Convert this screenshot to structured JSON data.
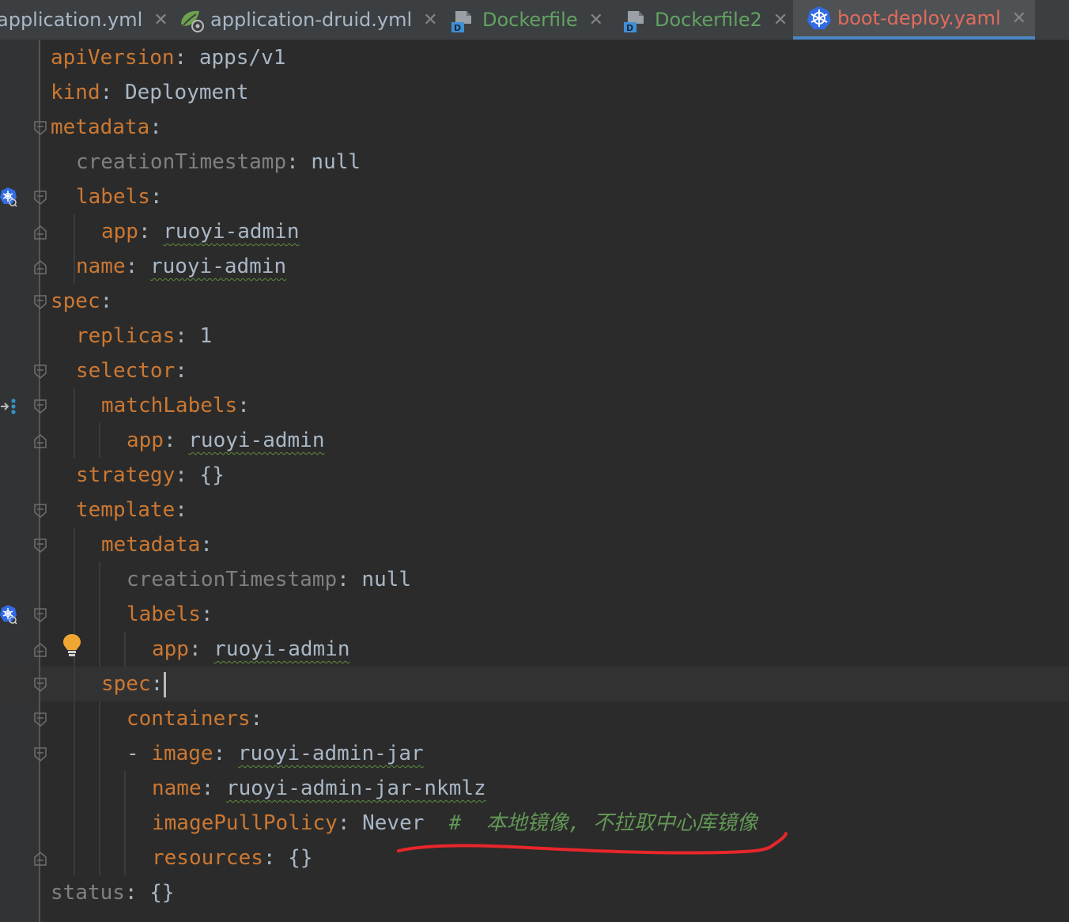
{
  "tabs": [
    {
      "label": "application.yml",
      "kind": "yml",
      "icon": "yml-file-icon"
    },
    {
      "label": "application-druid.yml",
      "kind": "spring-yml",
      "icon": "spring-yml-icon"
    },
    {
      "label": "Dockerfile",
      "kind": "docker",
      "icon": "dockerfile-icon"
    },
    {
      "label": "Dockerfile2",
      "kind": "docker",
      "icon": "dockerfile-icon"
    },
    {
      "label": "boot-deploy.yaml",
      "kind": "kubernetes",
      "icon": "kubernetes-icon",
      "active": true
    }
  ],
  "colors": {
    "key": "#cc7832",
    "key_unused": "#808080",
    "value": "#a9b7c6",
    "comment": "#629755",
    "active_tab_text": "#e26b5d",
    "docker_tab_text": "#62a362",
    "annotation_red": "#e8262b",
    "tab_underline": "#4a88c7"
  },
  "code_lines": [
    {
      "key": "apiVersion",
      "value": "apps/v1"
    },
    {
      "key": "kind",
      "value": "Deployment"
    },
    {
      "key": "metadata",
      "value": ""
    },
    {
      "key": "creationTimestamp",
      "value": "null"
    },
    {
      "key": "labels",
      "value": ""
    },
    {
      "key": "app",
      "value": "ruoyi-admin"
    },
    {
      "key": "name",
      "value": "ruoyi-admin"
    },
    {
      "key": "spec",
      "value": ""
    },
    {
      "key": "replicas",
      "value": "1"
    },
    {
      "key": "selector",
      "value": ""
    },
    {
      "key": "matchLabels",
      "value": ""
    },
    {
      "key": "app",
      "value": "ruoyi-admin"
    },
    {
      "key": "strategy",
      "value": "{}"
    },
    {
      "key": "template",
      "value": ""
    },
    {
      "key": "metadata",
      "value": ""
    },
    {
      "key": "creationTimestamp",
      "value": "null"
    },
    {
      "key": "labels",
      "value": ""
    },
    {
      "key": "app",
      "value": "ruoyi-admin"
    },
    {
      "key": "spec",
      "value": ""
    },
    {
      "key": "containers",
      "value": ""
    },
    {
      "key": "image",
      "value": "ruoyi-admin-jar"
    },
    {
      "key": "name",
      "value": "ruoyi-admin-jar-nkmlz"
    },
    {
      "key": "imagePullPolicy",
      "value": "Never",
      "comment": "#  本地镜像, 不拉取中心库镜像"
    },
    {
      "key": "resources",
      "value": "{}"
    },
    {
      "key": "status",
      "value": "{}"
    }
  ]
}
